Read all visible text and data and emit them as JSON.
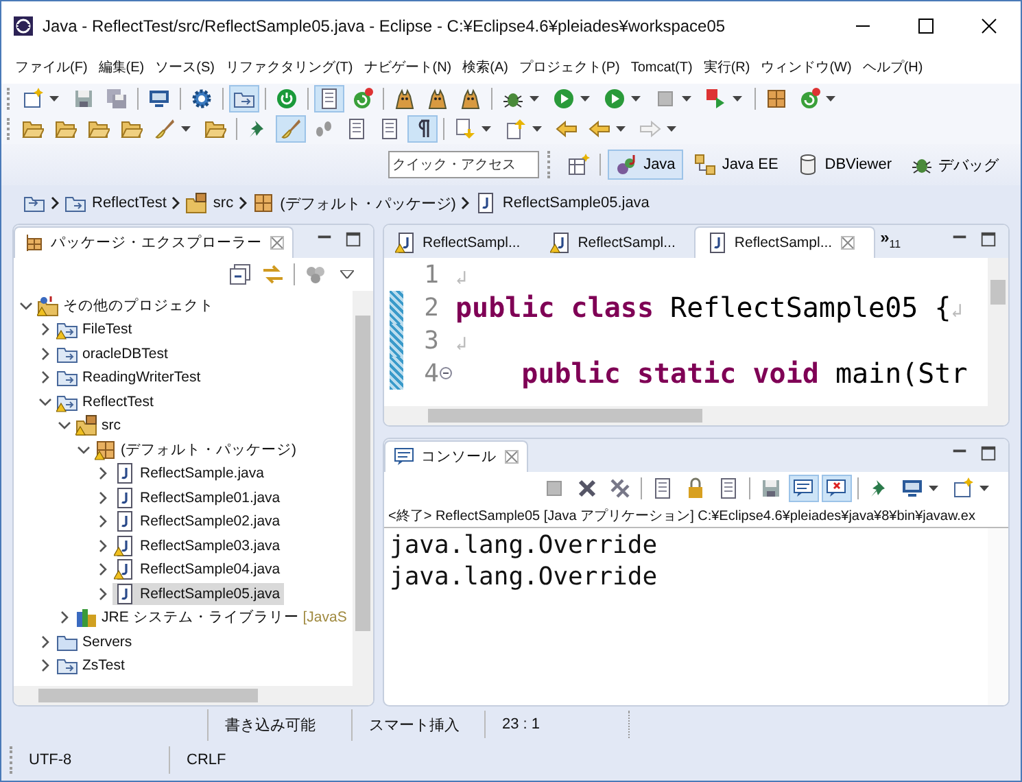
{
  "window": {
    "title": "Java - ReflectTest/src/ReflectSample05.java - Eclipse - C:¥Eclipse4.6¥pleiades¥workspace05"
  },
  "menu": [
    "ファイル(F)",
    "編集(E)",
    "ソース(S)",
    "リファクタリング(T)",
    "ナビゲート(N)",
    "検索(A)",
    "プロジェクト(P)",
    "Tomcat(T)",
    "実行(R)",
    "ウィンドウ(W)",
    "ヘルプ(H)"
  ],
  "toolbar_rows": [
    [
      {
        "kind": "new",
        "pressed": false,
        "dropdown": true
      },
      {
        "kind": "save",
        "pressed": false,
        "dropdown": false
      },
      {
        "kind": "save-all",
        "pressed": false,
        "dropdown": false
      },
      {
        "kind": "separator"
      },
      {
        "kind": "monitor",
        "pressed": false,
        "dropdown": false
      },
      {
        "kind": "separator"
      },
      {
        "kind": "gear",
        "pressed": false,
        "dropdown": false
      },
      {
        "kind": "separator"
      },
      {
        "kind": "folder",
        "pressed": true,
        "dropdown": false
      },
      {
        "kind": "separator"
      },
      {
        "kind": "power",
        "pressed": false,
        "dropdown": false
      },
      {
        "kind": "separator"
      },
      {
        "kind": "document",
        "pressed": true,
        "dropdown": false
      },
      {
        "kind": "refresh",
        "pressed": false,
        "dropdown": false
      },
      {
        "kind": "separator"
      },
      {
        "kind": "cat",
        "pressed": false,
        "dropdown": false
      },
      {
        "kind": "cat",
        "pressed": false,
        "dropdown": false
      },
      {
        "kind": "cat",
        "pressed": false,
        "dropdown": false
      },
      {
        "kind": "separator"
      },
      {
        "kind": "bug",
        "pressed": false,
        "dropdown": true
      },
      {
        "kind": "play",
        "pressed": false,
        "dropdown": true
      },
      {
        "kind": "play",
        "pressed": false,
        "dropdown": true
      },
      {
        "kind": "stop",
        "pressed": false,
        "dropdown": true
      },
      {
        "kind": "flag",
        "pressed": false,
        "dropdown": true
      },
      {
        "kind": "separator"
      },
      {
        "kind": "package",
        "pressed": false,
        "dropdown": false
      },
      {
        "kind": "refresh",
        "pressed": false,
        "dropdown": true
      }
    ],
    [
      {
        "kind": "open-folder",
        "pressed": false,
        "dropdown": false
      },
      {
        "kind": "open-folder",
        "pressed": false,
        "dropdown": false
      },
      {
        "kind": "open-folder",
        "pressed": false,
        "dropdown": false
      },
      {
        "kind": "open-folder",
        "pressed": false,
        "dropdown": false
      },
      {
        "kind": "brush",
        "pressed": false,
        "dropdown": true
      },
      {
        "kind": "open-folder",
        "pressed": false,
        "dropdown": false
      },
      {
        "kind": "separator"
      },
      {
        "kind": "pin",
        "pressed": false,
        "dropdown": false
      },
      {
        "kind": "brush",
        "pressed": true,
        "dropdown": false
      },
      {
        "kind": "footprint",
        "pressed": false,
        "dropdown": false
      },
      {
        "kind": "document",
        "pressed": false,
        "dropdown": false
      },
      {
        "kind": "document",
        "pressed": false,
        "dropdown": false
      },
      {
        "kind": "pilcrow",
        "pressed": true,
        "dropdown": false
      },
      {
        "kind": "separator"
      },
      {
        "kind": "arrow-down",
        "pressed": false,
        "dropdown": true
      },
      {
        "kind": "arrow-up",
        "pressed": false,
        "dropdown": true
      },
      {
        "kind": "arrow-left",
        "pressed": false,
        "dropdown": false
      },
      {
        "kind": "arrow-left",
        "pressed": false,
        "dropdown": true
      },
      {
        "kind": "arrow-right",
        "pressed": false,
        "dropdown": true
      }
    ]
  ],
  "quick_access": {
    "placeholder": "クイック・アクセス"
  },
  "perspectives": [
    {
      "label": "Java",
      "kind": "java",
      "selected": true
    },
    {
      "label": "Java EE",
      "kind": "javaee",
      "selected": false
    },
    {
      "label": "DBViewer",
      "kind": "database",
      "selected": false
    },
    {
      "label": "デバッグ",
      "kind": "bug",
      "selected": false
    }
  ],
  "breadcrumb": [
    {
      "label": "ReflectTest",
      "kind": "project"
    },
    {
      "label": "src",
      "kind": "source-folder"
    },
    {
      "label": "(デフォルト・パッケージ)",
      "kind": "package"
    },
    {
      "label": "ReflectSample05.java",
      "kind": "java-file"
    }
  ],
  "package_explorer": {
    "title": "パッケージ・エクスプローラー",
    "tree": [
      {
        "label": "その他のプロジェクト",
        "kind": "working-set",
        "warning": true,
        "expanded": true,
        "selected": false,
        "children": [
          {
            "label": "FileTest",
            "kind": "project",
            "warning": true,
            "expanded": false,
            "selected": false
          },
          {
            "label": "oracleDBTest",
            "kind": "project",
            "warning": false,
            "expanded": false,
            "selected": false
          },
          {
            "label": "ReadingWriterTest",
            "kind": "project",
            "warning": false,
            "expanded": false,
            "selected": false
          },
          {
            "label": "ReflectTest",
            "kind": "project",
            "warning": true,
            "expanded": true,
            "selected": false,
            "children": [
              {
                "label": "src",
                "kind": "source-folder",
                "warning": true,
                "expanded": true,
                "selected": false,
                "children": [
                  {
                    "label": "(デフォルト・パッケージ)",
                    "kind": "package",
                    "warning": true,
                    "expanded": true,
                    "selected": false,
                    "children": [
                      {
                        "label": "ReflectSample.java",
                        "kind": "java-file",
                        "warning": false,
                        "expanded": false,
                        "selected": false
                      },
                      {
                        "label": "ReflectSample01.java",
                        "kind": "java-file",
                        "warning": false,
                        "expanded": false,
                        "selected": false
                      },
                      {
                        "label": "ReflectSample02.java",
                        "kind": "java-file",
                        "warning": false,
                        "expanded": false,
                        "selected": false
                      },
                      {
                        "label": "ReflectSample03.java",
                        "kind": "java-file",
                        "warning": true,
                        "expanded": false,
                        "selected": false
                      },
                      {
                        "label": "ReflectSample04.java",
                        "kind": "java-file",
                        "warning": true,
                        "expanded": false,
                        "selected": false
                      },
                      {
                        "label": "ReflectSample05.java",
                        "kind": "java-file",
                        "warning": false,
                        "expanded": false,
                        "selected": true
                      }
                    ]
                  }
                ]
              },
              {
                "label": "JRE システム・ライブラリー",
                "decoration": "[JavaS",
                "kind": "library",
                "warning": false,
                "expanded": false,
                "selected": false
              }
            ]
          },
          {
            "label": "Servers",
            "kind": "folder",
            "warning": false,
            "expanded": false,
            "selected": false
          },
          {
            "label": "ZsTest",
            "kind": "project",
            "warning": false,
            "expanded": false,
            "selected": false
          }
        ]
      }
    ]
  },
  "editor": {
    "tabs": [
      {
        "label": "ReflectSampl...",
        "warning": true,
        "selected": false
      },
      {
        "label": "ReflectSampl...",
        "warning": true,
        "selected": false
      },
      {
        "label": "ReflectSampl...",
        "warning": false,
        "selected": true
      }
    ],
    "overflow_mark": "»",
    "overflow_count": "11",
    "lines": [
      {
        "number": "1",
        "changed": false,
        "foldable": false,
        "eol": "↲"
      },
      {
        "number": "2",
        "changed": true,
        "foldable": false,
        "eol": "↲",
        "tokens": [
          {
            "text": "public class",
            "kind": "keyword"
          },
          {
            "text": " ReflectSample05 {",
            "kind": "plain"
          }
        ]
      },
      {
        "number": "3",
        "changed": true,
        "foldable": false,
        "eol": "↲"
      },
      {
        "number": "4",
        "changed": true,
        "foldable": true,
        "tokens": [
          {
            "text": "    public static void",
            "kind": "keyword"
          },
          {
            "text": " main(Str",
            "kind": "plain"
          }
        ]
      }
    ]
  },
  "console": {
    "title": "コンソール",
    "toolbar": [
      {
        "kind": "stop",
        "pressed": false
      },
      {
        "kind": "remove",
        "pressed": false
      },
      {
        "kind": "remove-all",
        "pressed": false
      },
      {
        "kind": "separator"
      },
      {
        "kind": "document",
        "pressed": false
      },
      {
        "kind": "lock",
        "pressed": false
      },
      {
        "kind": "document",
        "pressed": false
      },
      {
        "kind": "separator"
      },
      {
        "kind": "save",
        "pressed": false
      },
      {
        "kind": "console",
        "pressed": true
      },
      {
        "kind": "console-error",
        "pressed": true
      },
      {
        "kind": "separator"
      },
      {
        "kind": "pin",
        "pressed": false
      },
      {
        "kind": "monitor",
        "pressed": false,
        "dropdown": true
      },
      {
        "kind": "new",
        "pressed": false,
        "dropdown": true
      }
    ],
    "status": "<終了> ReflectSample05 [Java アプリケーション] C:¥Eclipse4.6¥pleiades¥java¥8¥bin¥javaw.ex",
    "output": [
      "java.lang.Override",
      "java.lang.Override"
    ]
  },
  "status_bar": {
    "row_1": [
      "書き込み可能",
      "スマート挿入",
      "23 : 1"
    ],
    "row_2": [
      "UTF-8",
      "CRLF"
    ]
  }
}
